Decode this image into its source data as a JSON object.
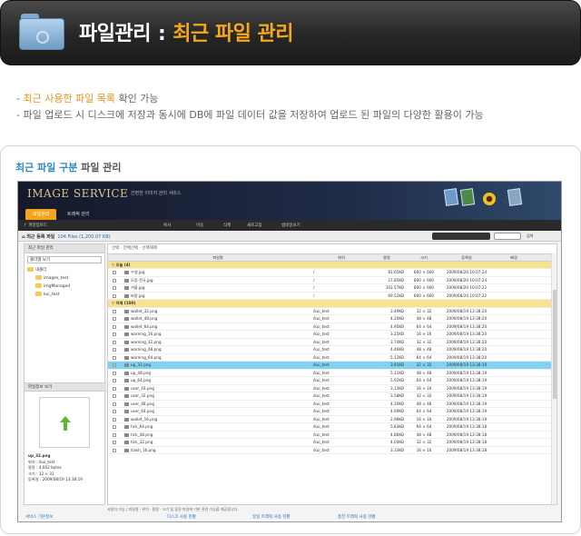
{
  "banner": {
    "title": "파일관리",
    "separator": ":",
    "subtitle": "최근 파일 관리"
  },
  "notes": {
    "line1_highlight": "최근 사용한 파일 목록",
    "line1_rest": " 확인 가능",
    "line2": "파일 업로드 시 디스크에 저장과 동시에 DB에 파일 데이터 값을 저장하여 업로드 된 파일의 다양한 활용이 가능"
  },
  "panel": {
    "title_blue": "최근 파일 구분",
    "title_rest": " 파일 관리"
  },
  "app": {
    "logo": "IMAGE SERVICE",
    "logo_sub": "간편한 이미지 관리 서비스",
    "tabs": [
      "파일관리",
      "트래픽 관리"
    ],
    "toolbar": [
      "↑ 파일업로드",
      "복사",
      "이동",
      "삭제",
      "새로고침",
      "썸네일보기"
    ],
    "path_title": "최근 등록 파일",
    "path_count": "104 Files (1,200.07 KB)",
    "search_label": "검색",
    "left": {
      "header": "최근 파일 관리",
      "select": "폴더별 보기",
      "tree": [
        "내폴더",
        "images_test",
        "imgManaged",
        "kui_test"
      ],
      "preview_header": "파일정보 보기",
      "info": [
        "up_32.png",
        "위치 : /kui_test",
        "용량 : 4,002 bytes",
        "크기 : 32 × 32",
        "등록일 : 2009/08/19 13:38:19"
      ]
    },
    "crumbs": "선택 · 전체선택 · 선택해제",
    "columns": [
      "",
      "파일명",
      "위치",
      "용량",
      "크기",
      "등록일",
      "배경"
    ],
    "rows": [
      {
        "type": "group",
        "name": "▽ 오늘 (4)"
      },
      {
        "name": "수영.jpg",
        "loc": "/",
        "size": "81.65KB",
        "dim": "800 × 600",
        "date": "2009/08/20 10:07:24"
      },
      {
        "name": "모음 전국.jpg",
        "loc": "/",
        "size": "27.85KB",
        "dim": "800 × 600",
        "date": "2009/08/20 10:07:24"
      },
      {
        "name": "겨울.jpg",
        "loc": "/",
        "size": "102.57KB",
        "dim": "800 × 600",
        "date": "2009/08/20 10:07:22"
      },
      {
        "name": "바람.jpg",
        "loc": "/",
        "size": "69.52KB",
        "dim": "800 × 600",
        "date": "2009/08/20 10:07:22"
      },
      {
        "type": "group",
        "name": "▽ 어제 (100)"
      },
      {
        "name": "wallet_32.png",
        "loc": "/kui_test",
        "size": "3.49KB",
        "dim": "32 × 32",
        "date": "2009/08/19 13:38:20"
      },
      {
        "name": "wallet_48.png",
        "loc": "/kui_test",
        "size": "4.20KB",
        "dim": "48 × 48",
        "date": "2009/08/19 13:38:20"
      },
      {
        "name": "wallet_64.png",
        "loc": "/kui_test",
        "size": "4.95KB",
        "dim": "64 × 64",
        "date": "2009/08/19 13:38:20"
      },
      {
        "name": "warning_16.png",
        "loc": "/kui_test",
        "size": "3.25KB",
        "dim": "16 × 16",
        "date": "2009/08/19 13:38:20"
      },
      {
        "name": "warning_32.png",
        "loc": "/kui_test",
        "size": "3.74KB",
        "dim": "32 × 32",
        "date": "2009/08/19 13:38:20"
      },
      {
        "name": "warning_48.png",
        "loc": "/kui_test",
        "size": "4.46KB",
        "dim": "48 × 48",
        "date": "2009/08/19 13:38:20"
      },
      {
        "name": "warning_64.png",
        "loc": "/kui_test",
        "size": "5.12KB",
        "dim": "64 × 64",
        "date": "2009/08/19 13:38:20"
      },
      {
        "name": "up_32.png",
        "loc": "/kui_test",
        "size": "3.91KB",
        "dim": "32 × 32",
        "date": "2009/08/19 13:38:19",
        "selected": true
      },
      {
        "name": "up_48.png",
        "loc": "/kui_test",
        "size": "5.11KB",
        "dim": "48 × 48",
        "date": "2009/08/19 13:38:19"
      },
      {
        "name": "up_64.png",
        "loc": "/kui_test",
        "size": "5.92KB",
        "dim": "64 × 64",
        "date": "2009/08/19 13:38:19"
      },
      {
        "name": "user_16.png",
        "loc": "/kui_test",
        "size": "3.13KB",
        "dim": "16 × 16",
        "date": "2009/08/19 13:38:19"
      },
      {
        "name": "user_32.png",
        "loc": "/kui_test",
        "size": "3.58KB",
        "dim": "32 × 32",
        "date": "2009/08/19 13:38:19"
      },
      {
        "name": "user_48.png",
        "loc": "/kui_test",
        "size": "4.20KB",
        "dim": "48 × 48",
        "date": "2009/08/19 13:38:19"
      },
      {
        "name": "user_64.png",
        "loc": "/kui_test",
        "size": "4.69KB",
        "dim": "64 × 64",
        "date": "2009/08/19 13:38:19"
      },
      {
        "name": "wallet_16.png",
        "loc": "/kui_test",
        "size": "2.98KB",
        "dim": "16 × 16",
        "date": "2009/08/19 13:38:19"
      },
      {
        "name": "tick_64.png",
        "loc": "/kui_test",
        "size": "5.83KB",
        "dim": "64 × 64",
        "date": "2009/08/19 13:38:18"
      },
      {
        "name": "tick_48.png",
        "loc": "/kui_test",
        "size": "4.86KB",
        "dim": "48 × 48",
        "date": "2009/08/19 13:38:18"
      },
      {
        "name": "tick_32.png",
        "loc": "/kui_test",
        "size": "4.04KB",
        "dim": "32 × 32",
        "date": "2009/08/19 13:38:18"
      },
      {
        "name": "trash_16.png",
        "loc": "/kui_test",
        "size": "3.33KB",
        "dim": "16 × 16",
        "date": "2009/08/19 13:38:18"
      }
    ],
    "footnote": "사용자 가능 | 파일명 · 위치 · 용량 · 크기 및 동일 파일에 기본 관련 기능을 제공합니다.",
    "widgets": [
      "서비스 기본정보",
      "디스크 사용 현황",
      "일일 트래픽 사용 현황",
      "총전 트래픽 사용 현황"
    ]
  },
  "colors": {
    "accent": "#f6a81b",
    "blue": "#2a8ac2",
    "highlight": "#e8931a",
    "selected_row": "#7fd2f0",
    "group_row": "#f7e38f"
  }
}
